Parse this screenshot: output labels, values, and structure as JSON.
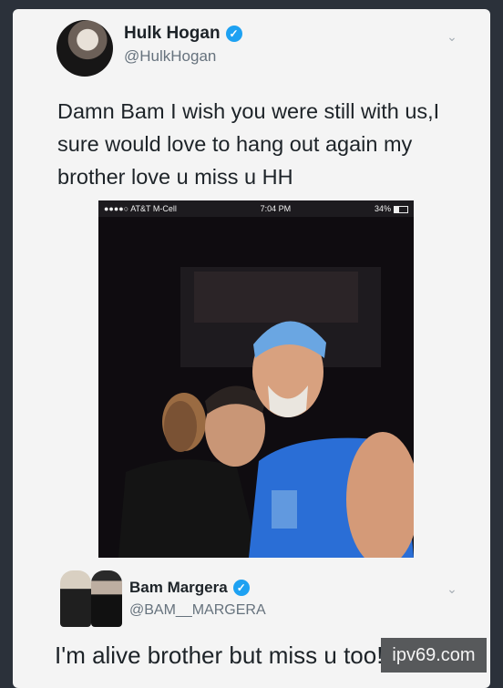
{
  "tweet1": {
    "author_name": "Hulk Hogan",
    "handle": "@HulkHogan",
    "verified_icon": "verified-badge-icon",
    "text": "Damn Bam I wish you were still with us,I sure would love to hang out again my brother love u miss u HH"
  },
  "embedded_screenshot": {
    "carrier": "AT&T M-Cell",
    "time": "7:04 PM",
    "battery": "34%"
  },
  "tweet2": {
    "author_name": "Bam Margera",
    "handle": "@BAM__MARGERA",
    "verified_icon": "verified-badge-icon",
    "text": "I'm alive brother but miss u too!"
  },
  "watermark": "ipv69.com",
  "colors": {
    "verified": "#1da1f2",
    "background": "#2b313a",
    "card": "#f4f4f4"
  }
}
